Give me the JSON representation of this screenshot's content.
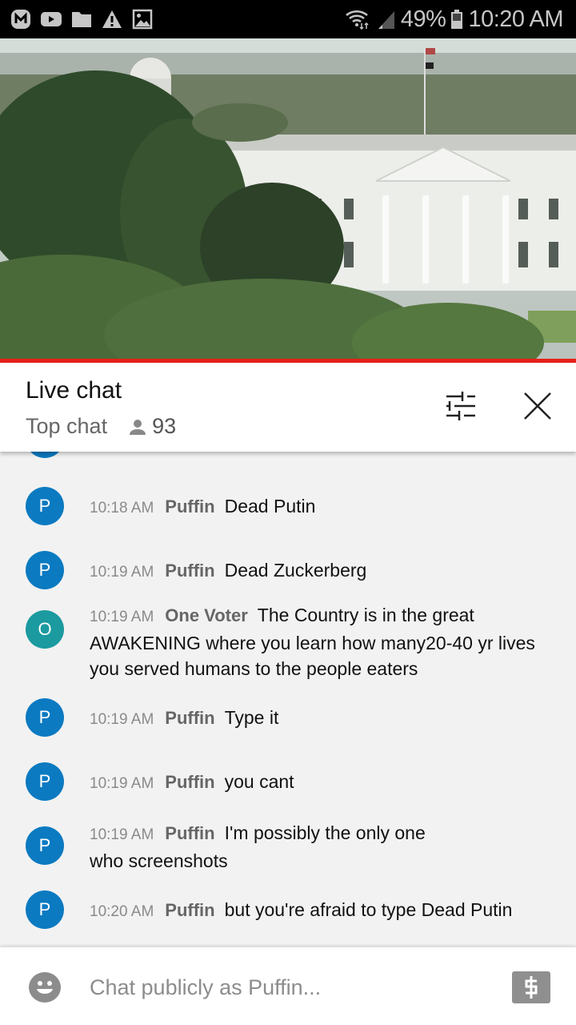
{
  "status_bar": {
    "notification_icons": [
      "app-icon",
      "youtube-icon",
      "folder-icon",
      "warning-icon",
      "image-icon"
    ],
    "battery": "49%",
    "time": "10:20 AM"
  },
  "video": {
    "scene": "White House live camera view",
    "progress_color": "#e62117"
  },
  "chat_header": {
    "title": "Live chat",
    "mode": "Top chat",
    "viewer_count": "93"
  },
  "messages": [
    {
      "avatar_letter": "P",
      "avatar_color": "#0b7ac1",
      "time": "10:18 AM",
      "author": "Puffin",
      "text": "Dead Putin"
    },
    {
      "avatar_letter": "P",
      "avatar_color": "#0b7ac1",
      "time": "10:19 AM",
      "author": "Puffin",
      "text": "Dead Zuckerberg"
    },
    {
      "avatar_letter": "O",
      "avatar_color": "#1b9aa0",
      "time": "10:19 AM",
      "author": "One Voter",
      "text": "The Country is in the great AWAKENING where you learn how many20-40 yr lives you served humans to the people eaters"
    },
    {
      "avatar_letter": "P",
      "avatar_color": "#0b7ac1",
      "time": "10:19 AM",
      "author": "Puffin",
      "text": "Type it"
    },
    {
      "avatar_letter": "P",
      "avatar_color": "#0b7ac1",
      "time": "10:19 AM",
      "author": "Puffin",
      "text": "you cant"
    },
    {
      "avatar_letter": "P",
      "avatar_color": "#0b7ac1",
      "time": "10:19 AM",
      "author": "Puffin",
      "text": "I'm possibly the only one who screenshots"
    },
    {
      "avatar_letter": "P",
      "avatar_color": "#0b7ac1",
      "time": "10:20 AM",
      "author": "Puffin",
      "text": "but you're afraid to type Dead Putin"
    }
  ],
  "input_bar": {
    "placeholder": "Chat publicly as Puffin..."
  }
}
